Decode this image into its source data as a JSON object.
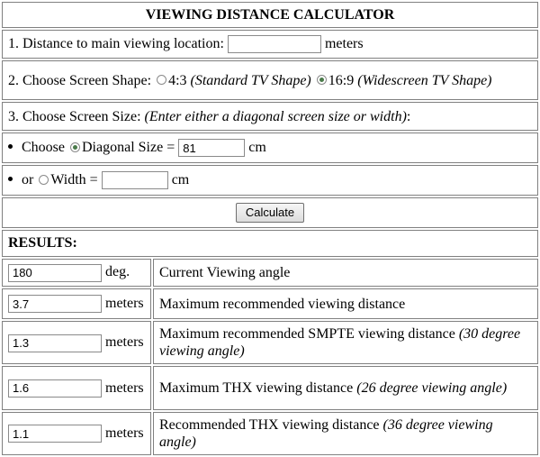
{
  "title": "VIEWING DISTANCE CALCULATOR",
  "step1": {
    "label": "1. Distance to main viewing location:",
    "value": "",
    "unit": "meters"
  },
  "step2": {
    "label": "2. Choose Screen Shape:",
    "options": [
      {
        "value": "4:3",
        "note": "(Standard TV Shape)",
        "selected": false
      },
      {
        "value": "16:9",
        "note": "(Widescreen TV Shape)",
        "selected": true
      }
    ]
  },
  "step3": {
    "label": "3. Choose Screen Size:",
    "note": "(Enter either a diagonal screen size or width)",
    "suffix": ":"
  },
  "diagonal": {
    "prefix": "Choose",
    "label": "Diagonal Size =",
    "value": "81",
    "unit": "cm",
    "selected": true
  },
  "width": {
    "prefix": "or",
    "label": "Width =",
    "value": "",
    "unit": "cm",
    "selected": false
  },
  "calculate_label": "Calculate",
  "results_label": "RESULTS:",
  "results": [
    {
      "value": "180",
      "unit": "deg.",
      "desc": "Current Viewing angle",
      "note": ""
    },
    {
      "value": "3.7",
      "unit": "meters",
      "desc": "Maximum recommended viewing distance",
      "note": ""
    },
    {
      "value": "1.3",
      "unit": "meters",
      "desc": "Maximum recommended SMPTE viewing distance",
      "note": "(30 degree viewing angle)"
    },
    {
      "value": "1.6",
      "unit": "meters",
      "desc": "Maximum THX viewing distance",
      "note": "(26 degree viewing angle)"
    },
    {
      "value": "1.1",
      "unit": "meters",
      "desc": "Recommended THX viewing distance",
      "note": "(36 degree viewing angle)"
    }
  ]
}
